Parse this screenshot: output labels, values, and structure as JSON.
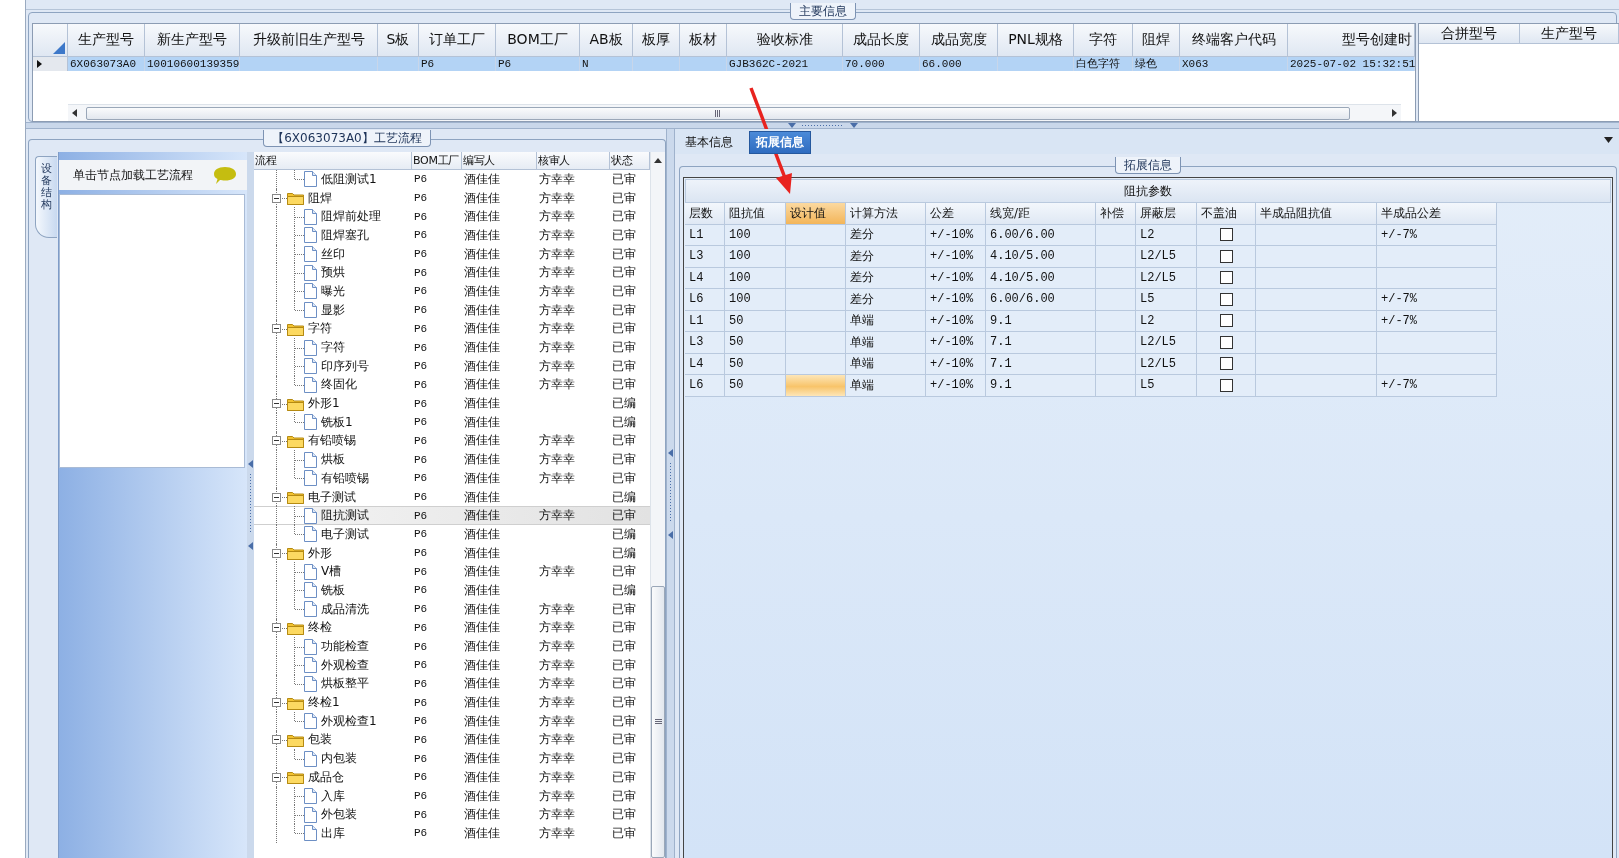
{
  "main_info": {
    "title": "主要信息",
    "columns": [
      "生产型号",
      "新生产型号",
      "升级前旧生产型号",
      "S板",
      "订单工厂",
      "BOM工厂",
      "AB板",
      "板厚",
      "板材",
      "验收标准",
      "成品长度",
      "成品宽度",
      "PNL规格",
      "字符",
      "阻焊",
      "终端客户代码",
      "型号创建时"
    ],
    "rows": [
      {
        "selected": true,
        "cells": [
          "6X063073A0",
          "10010600139359",
          null,
          null,
          "P6",
          "P6",
          "N",
          null,
          null,
          "GJB362C-2021",
          "70.000",
          "66.000",
          null,
          "白色字符",
          "绿色",
          "X063",
          "2025-07-02 15:32:51"
        ]
      }
    ],
    "side_columns": [
      "合拼型号",
      "生产型号"
    ]
  },
  "process": {
    "title": "【6X063073A0】工艺流程",
    "side_tab": "设备结构",
    "hint": "单击节点加载工艺流程",
    "columns": [
      "流程",
      "BOM工厂",
      "编写人",
      "核审人",
      "状态"
    ],
    "nodes": [
      {
        "children": [
          {
            "name": "低阻测试1",
            "bom": "P6",
            "writer": "酒佳佳",
            "reviewer": "方幸幸",
            "status": "已审",
            "selected": false
          }
        ]
      },
      {
        "name": "阻焊",
        "bom": "P6",
        "writer": "酒佳佳",
        "reviewer": "方幸幸",
        "status": "已审",
        "selected": false,
        "expanded": true,
        "children": [
          {
            "name": "阻焊前处理",
            "bom": "P6",
            "writer": "酒佳佳",
            "reviewer": "方幸幸",
            "status": "已审",
            "selected": false
          },
          {
            "name": "阻焊塞孔",
            "bom": "P6",
            "writer": "酒佳佳",
            "reviewer": "方幸幸",
            "status": "已审",
            "selected": false
          },
          {
            "name": "丝印",
            "bom": "P6",
            "writer": "酒佳佳",
            "reviewer": "方幸幸",
            "status": "已审",
            "selected": false
          },
          {
            "name": "预烘",
            "bom": "P6",
            "writer": "酒佳佳",
            "reviewer": "方幸幸",
            "status": "已审",
            "selected": false
          },
          {
            "name": "曝光",
            "bom": "P6",
            "writer": "酒佳佳",
            "reviewer": "方幸幸",
            "status": "已审",
            "selected": false
          },
          {
            "name": "显影",
            "bom": "P6",
            "writer": "酒佳佳",
            "reviewer": "方幸幸",
            "status": "已审",
            "selected": false
          }
        ]
      },
      {
        "name": "字符",
        "bom": "P6",
        "writer": "酒佳佳",
        "reviewer": "方幸幸",
        "status": "已审",
        "selected": false,
        "expanded": true,
        "children": [
          {
            "name": "字符",
            "bom": "P6",
            "writer": "酒佳佳",
            "reviewer": "方幸幸",
            "status": "已审",
            "selected": false
          },
          {
            "name": "印序列号",
            "bom": "P6",
            "writer": "酒佳佳",
            "reviewer": "方幸幸",
            "status": "已审",
            "selected": false
          },
          {
            "name": "终固化",
            "bom": "P6",
            "writer": "酒佳佳",
            "reviewer": "方幸幸",
            "status": "已审",
            "selected": false
          }
        ]
      },
      {
        "name": "外形1",
        "bom": "P6",
        "writer": "酒佳佳",
        "status": "已编",
        "selected": false,
        "expanded": true,
        "children": [
          {
            "name": "铣板1",
            "bom": "P6",
            "writer": "酒佳佳",
            "status": "已编",
            "selected": false
          }
        ]
      },
      {
        "name": "有铅喷锡",
        "bom": "P6",
        "writer": "酒佳佳",
        "reviewer": "方幸幸",
        "status": "已审",
        "selected": false,
        "expanded": true,
        "children": [
          {
            "name": "烘板",
            "bom": "P6",
            "writer": "酒佳佳",
            "reviewer": "方幸幸",
            "status": "已审",
            "selected": false
          },
          {
            "name": "有铅喷锡",
            "bom": "P6",
            "writer": "酒佳佳",
            "reviewer": "方幸幸",
            "status": "已审",
            "selected": false
          }
        ]
      },
      {
        "name": "电子测试",
        "bom": "P6",
        "writer": "酒佳佳",
        "status": "已编",
        "selected": false,
        "expanded": true,
        "children": [
          {
            "name": "阻抗测试",
            "bom": "P6",
            "writer": "酒佳佳",
            "reviewer": "方幸幸",
            "status": "已审",
            "selected": true
          },
          {
            "name": "电子测试",
            "bom": "P6",
            "writer": "酒佳佳",
            "status": "已编",
            "selected": false
          }
        ]
      },
      {
        "name": "外形",
        "bom": "P6",
        "writer": "酒佳佳",
        "status": "已编",
        "selected": false,
        "expanded": true,
        "children": [
          {
            "name": "V槽",
            "bom": "P6",
            "writer": "酒佳佳",
            "reviewer": "方幸幸",
            "status": "已审",
            "selected": false
          },
          {
            "name": "铣板",
            "bom": "P6",
            "writer": "酒佳佳",
            "status": "已编",
            "selected": false
          },
          {
            "name": "成品清洗",
            "bom": "P6",
            "writer": "酒佳佳",
            "reviewer": "方幸幸",
            "status": "已审",
            "selected": false
          }
        ]
      },
      {
        "name": "终检",
        "bom": "P6",
        "writer": "酒佳佳",
        "reviewer": "方幸幸",
        "status": "已审",
        "selected": false,
        "expanded": true,
        "children": [
          {
            "name": "功能检查",
            "bom": "P6",
            "writer": "酒佳佳",
            "reviewer": "方幸幸",
            "status": "已审",
            "selected": false
          },
          {
            "name": "外观检查",
            "bom": "P6",
            "writer": "酒佳佳",
            "reviewer": "方幸幸",
            "status": "已审",
            "selected": false
          },
          {
            "name": "烘板整平",
            "bom": "P6",
            "writer": "酒佳佳",
            "reviewer": "方幸幸",
            "status": "已审",
            "selected": false
          }
        ]
      },
      {
        "name": "终检1",
        "bom": "P6",
        "writer": "酒佳佳",
        "reviewer": "方幸幸",
        "status": "已审",
        "selected": false,
        "expanded": true,
        "children": [
          {
            "name": "外观检查1",
            "bom": "P6",
            "writer": "酒佳佳",
            "reviewer": "方幸幸",
            "status": "已审",
            "selected": false
          }
        ]
      },
      {
        "name": "包装",
        "bom": "P6",
        "writer": "酒佳佳",
        "reviewer": "方幸幸",
        "status": "已审",
        "selected": false,
        "expanded": true,
        "children": [
          {
            "name": "内包装",
            "bom": "P6",
            "writer": "酒佳佳",
            "reviewer": "方幸幸",
            "status": "已审",
            "selected": false
          }
        ]
      },
      {
        "name": "成品仓",
        "bom": "P6",
        "writer": "酒佳佳",
        "reviewer": "方幸幸",
        "status": "已审",
        "selected": false,
        "expanded": true,
        "children": [
          {
            "name": "入库",
            "bom": "P6",
            "writer": "酒佳佳",
            "reviewer": "方幸幸",
            "status": "已审",
            "selected": false
          },
          {
            "name": "外包装",
            "bom": "P6",
            "writer": "酒佳佳",
            "reviewer": "方幸幸",
            "status": "已审",
            "selected": false
          },
          {
            "name": "出库",
            "bom": "P6",
            "writer": "酒佳佳",
            "reviewer": "方幸幸",
            "status": "已审",
            "selected": false
          }
        ]
      }
    ]
  },
  "tabs": [
    {
      "label": "基本信息",
      "selected": false
    },
    {
      "label": "拓展信息",
      "selected": true
    }
  ],
  "extended": {
    "title": "拓展信息",
    "table_title": "阻抗参数",
    "columns": [
      {
        "label": "层数",
        "selected": false
      },
      {
        "label": "阻抗值",
        "selected": false
      },
      {
        "label": "设计值",
        "selected": true
      },
      {
        "label": "计算方法",
        "selected": false
      },
      {
        "label": "公差",
        "selected": false
      },
      {
        "label": "线宽/距",
        "selected": false
      },
      {
        "label": "补偿",
        "selected": false
      },
      {
        "label": "屏蔽层",
        "selected": false
      },
      {
        "label": "不盖油",
        "selected": false
      },
      {
        "label": "半成品阻抗值",
        "selected": false
      },
      {
        "label": "半成品公差",
        "selected": false
      }
    ],
    "rows": [
      {
        "layer": "L1",
        "impedance": "100",
        "design_selected": false,
        "method": "差分",
        "tolerance": "+/-10%",
        "width_spacing": "6.00/6.00",
        "shield": "L2",
        "no_oil": false,
        "semi_tolerance": "+/-7%"
      },
      {
        "layer": "L3",
        "impedance": "100",
        "design_selected": false,
        "method": "差分",
        "tolerance": "+/-10%",
        "width_spacing": "4.10/5.00",
        "shield": "L2/L5",
        "no_oil": false
      },
      {
        "layer": "L4",
        "impedance": "100",
        "design_selected": false,
        "method": "差分",
        "tolerance": "+/-10%",
        "width_spacing": "4.10/5.00",
        "shield": "L2/L5",
        "no_oil": false
      },
      {
        "layer": "L6",
        "impedance": "100",
        "design_selected": false,
        "method": "差分",
        "tolerance": "+/-10%",
        "width_spacing": "6.00/6.00",
        "shield": "L5",
        "no_oil": false,
        "semi_tolerance": "+/-7%"
      },
      {
        "layer": "L1",
        "impedance": "50",
        "design_selected": false,
        "method": "单端",
        "tolerance": "+/-10%",
        "width_spacing": "9.1",
        "shield": "L2",
        "no_oil": false,
        "semi_tolerance": "+/-7%"
      },
      {
        "layer": "L3",
        "impedance": "50",
        "design_selected": false,
        "method": "单端",
        "tolerance": "+/-10%",
        "width_spacing": "7.1",
        "shield": "L2/L5",
        "no_oil": false
      },
      {
        "layer": "L4",
        "impedance": "50",
        "design_selected": false,
        "method": "单端",
        "tolerance": "+/-10%",
        "width_spacing": "7.1",
        "shield": "L2/L5",
        "no_oil": false
      },
      {
        "layer": "L6",
        "impedance": "50",
        "design_selected": true,
        "method": "单端",
        "tolerance": "+/-10%",
        "width_spacing": "9.1",
        "shield": "L5",
        "no_oil": false,
        "semi_tolerance": "+/-7%"
      }
    ]
  }
}
